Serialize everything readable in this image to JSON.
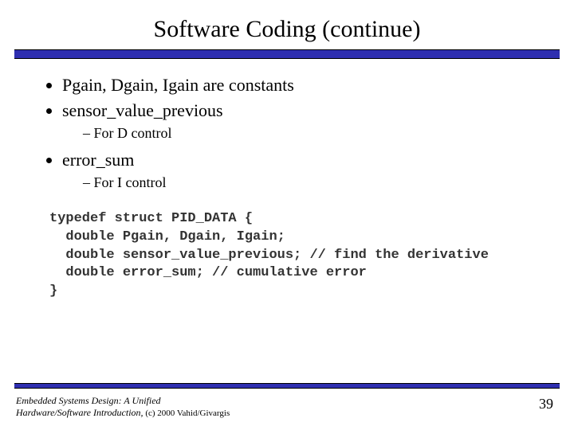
{
  "title": "Software Coding (continue)",
  "bullets": {
    "b1": "Pgain, Dgain, Igain are constants",
    "b2": "sensor_value_previous",
    "b2_sub": "For D control",
    "b3": "error_sum",
    "b3_sub": "For I control"
  },
  "code": {
    "l1": "typedef struct PID_DATA {",
    "l2": "  double Pgain, Dgain, Igain;",
    "l3": "  double sensor_value_previous; // find the derivative",
    "l4": "  double error_sum; // cumulative error",
    "l5": "}"
  },
  "footer": {
    "line1": "Embedded Systems Design: A Unified",
    "line2": "Hardware/Software Introduction,",
    "copyright": " (c) 2000 Vahid/Givargis"
  },
  "page_number": "39"
}
